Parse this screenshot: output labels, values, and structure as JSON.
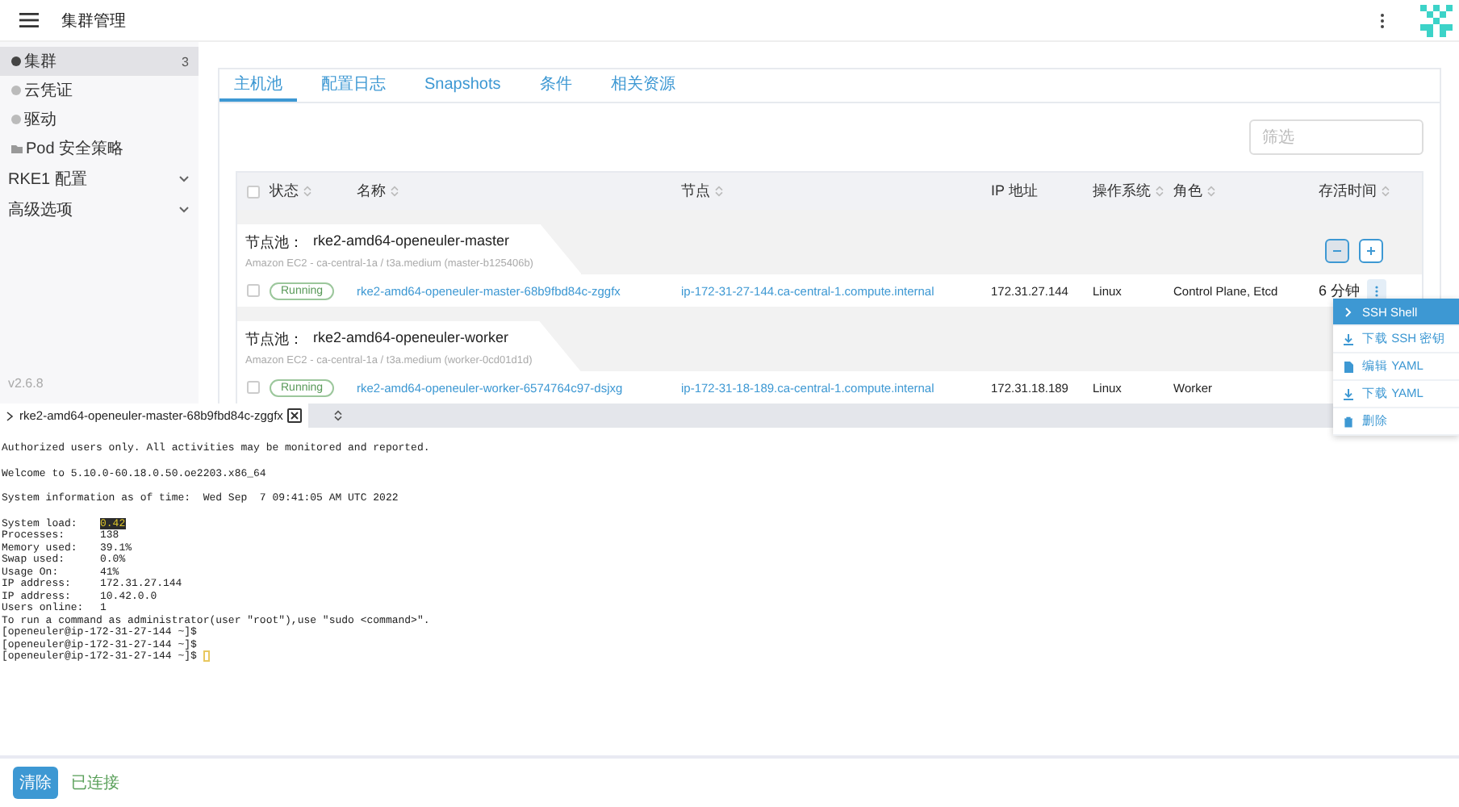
{
  "header": {
    "title": "集群管理"
  },
  "sidebar": {
    "items": [
      {
        "label": "集群",
        "count": "3",
        "kind": "dot",
        "selected": true
      },
      {
        "label": "云凭证",
        "kind": "dot",
        "selected": false
      },
      {
        "label": "驱动",
        "kind": "dot",
        "selected": false
      },
      {
        "label": "Pod 安全策略",
        "kind": "folder",
        "selected": false
      }
    ],
    "groups": [
      {
        "label": "RKE1 配置",
        "expanded": false
      },
      {
        "label": "高级选项",
        "expanded": false
      }
    ],
    "version": "v2.6.8"
  },
  "tabs": [
    {
      "label": "主机池",
      "selected": true
    },
    {
      "label": "配置日志",
      "selected": false
    },
    {
      "label": "Snapshots",
      "selected": false
    },
    {
      "label": "条件",
      "selected": false
    },
    {
      "label": "相关资源",
      "selected": false
    }
  ],
  "filter": {
    "placeholder": "筛选"
  },
  "table": {
    "columns": [
      {
        "label": "状态",
        "sortable": true
      },
      {
        "label": "名称",
        "sortable": true
      },
      {
        "label": "节点",
        "sortable": true
      },
      {
        "label": "IP 地址",
        "sortable": false
      },
      {
        "label": "操作系统",
        "sortable": true
      },
      {
        "label": "角色",
        "sortable": true
      },
      {
        "label": "存活时间",
        "sortable": true
      }
    ],
    "pools": [
      {
        "label": "节点池：",
        "name": "rke2-amd64-openeuler-master",
        "detail": "Amazon EC2 - ca-central-1a / t3a.medium (master-b125406b)",
        "scale_buttons": true,
        "rows": [
          {
            "checked": false,
            "status": "Running",
            "name": "rke2-amd64-openeuler-master-68b9fbd84c-zggfx",
            "node": "ip-172-31-27-144.ca-central-1.compute.internal",
            "ip": "172.31.27.144",
            "os": "Linux",
            "roles": "Control Plane, Etcd",
            "age": "6 分钟",
            "menu_open": true
          }
        ]
      },
      {
        "label": "节点池：",
        "name": "rke2-amd64-openeuler-worker",
        "detail": "Amazon EC2 - ca-central-1a / t3a.medium (worker-0cd01d1d)",
        "scale_buttons": false,
        "rows": [
          {
            "checked": false,
            "status": "Running",
            "name": "rke2-amd64-openeuler-worker-6574764c97-dsjxg",
            "node": "ip-172-31-18-189.ca-central-1.compute.internal",
            "ip": "172.31.18.189",
            "os": "Linux",
            "roles": "Worker",
            "menu_open": false
          }
        ]
      }
    ]
  },
  "action_menu": [
    {
      "label": "SSH Shell",
      "kind": "shell",
      "selected": true
    },
    {
      "label": "下载 SSH 密钥",
      "kind": "download",
      "selected": false
    },
    {
      "label": "编辑 YAML",
      "kind": "file",
      "selected": false
    },
    {
      "label": "下载 YAML",
      "kind": "download",
      "selected": false
    },
    {
      "label": "删除",
      "kind": "trash",
      "selected": false
    }
  ],
  "terminal": {
    "tab": "rke2-amd64-openeuler-master-68b9fbd84c-zggfx",
    "blocks": [
      {
        "lines": [
          {
            "text": "Authorized users only. All activities may be monitored and reported."
          }
        ]
      },
      {
        "lines": [
          {
            "text": "Welcome to 5.10.0-60.18.0.50.oe2203.x86_64"
          }
        ]
      },
      {
        "lines": [
          {
            "text": "System information as of time:  Wed Sep  7 09:41:05 AM UTC 2022"
          }
        ]
      },
      {
        "lines": [
          {
            "label": "System load:",
            "value": "0.42",
            "highlighted": true
          },
          {
            "label": "Processes:",
            "value": "138",
            "highlighted": false
          },
          {
            "label": "Memory used:",
            "value": "39.1%",
            "highlighted": false
          },
          {
            "label": "Swap used:",
            "value": "0.0%",
            "highlighted": false
          },
          {
            "label": "Usage On:",
            "value": "41%",
            "highlighted": false
          },
          {
            "label": "IP address:",
            "value": "172.31.27.144",
            "highlighted": false
          },
          {
            "label": "IP address:",
            "value": "10.42.0.0",
            "highlighted": false
          },
          {
            "label": "Users online:",
            "value": "1",
            "highlighted": false
          },
          {
            "text": "To run a command as administrator(user \"root\"),use \"sudo <command>\"."
          },
          {
            "text": "[openeuler@ip-172-31-27-144 ~]$"
          },
          {
            "text": "[openeuler@ip-172-31-27-144 ~]$"
          },
          {
            "text": "[openeuler@ip-172-31-27-144 ~]$",
            "cursor": true
          }
        ]
      }
    ]
  },
  "footer": {
    "button": "清除",
    "status": "已连接",
    "connected": true
  }
}
